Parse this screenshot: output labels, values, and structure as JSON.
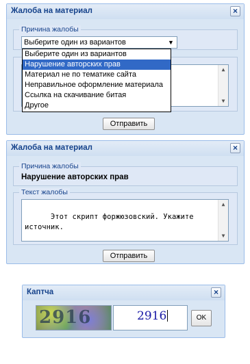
{
  "window1": {
    "title": "Жалоба на материал",
    "reason_legend": "Причина жалобы",
    "select_value": "Выберите один из вариантов",
    "options": [
      "Выберите один из вариантов",
      "Нарушение авторских прав",
      "Материал не по тематике сайта",
      "Неправильное оформление материала",
      "Ссылка на скачивание битая",
      "Другое"
    ],
    "highlighted_option": "Нарушение авторских прав",
    "submit_label": "Отправить"
  },
  "window2": {
    "title": "Жалоба на материал",
    "reason_legend": "Причина жалобы",
    "reason_value": "Нарушение авторских прав",
    "text_legend": "Текст жалобы",
    "text_value": "Этот скрипт форжюзовский. Укажите источник.",
    "submit_label": "Отправить"
  },
  "captcha_window": {
    "title": "Каптча",
    "image_text": "2916",
    "input_value": "2916",
    "ok_label": "OK"
  },
  "icons": {
    "close": "close-icon",
    "dropdown": "chevron-down-icon",
    "scroll_up": "scroll-up-icon",
    "scroll_down": "scroll-down-icon"
  },
  "colors": {
    "title_text": "#15428b",
    "window_bg": "#d9e6f4",
    "border": "#99bbe8",
    "selection": "#3169c6"
  }
}
